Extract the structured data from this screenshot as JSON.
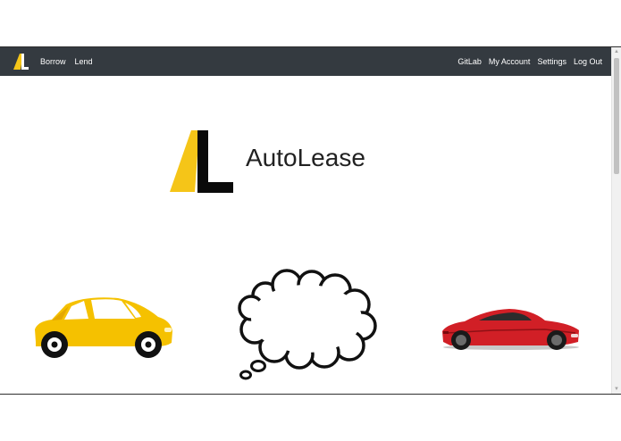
{
  "nav": {
    "left_items": [
      "Borrow",
      "Lend"
    ],
    "right_items": [
      "GitLab",
      "My Account",
      "Settings",
      "Log Out"
    ]
  },
  "hero": {
    "title": "AutoLease"
  },
  "colors": {
    "navbar": "#343a40",
    "brand_yellow": "#f5c518",
    "car_red": "#d11f26",
    "text": "#ffffff"
  },
  "icons": [
    "autolease-logo-icon",
    "yellow-car-icon",
    "thought-cloud-icon",
    "red-sports-car-icon"
  ]
}
